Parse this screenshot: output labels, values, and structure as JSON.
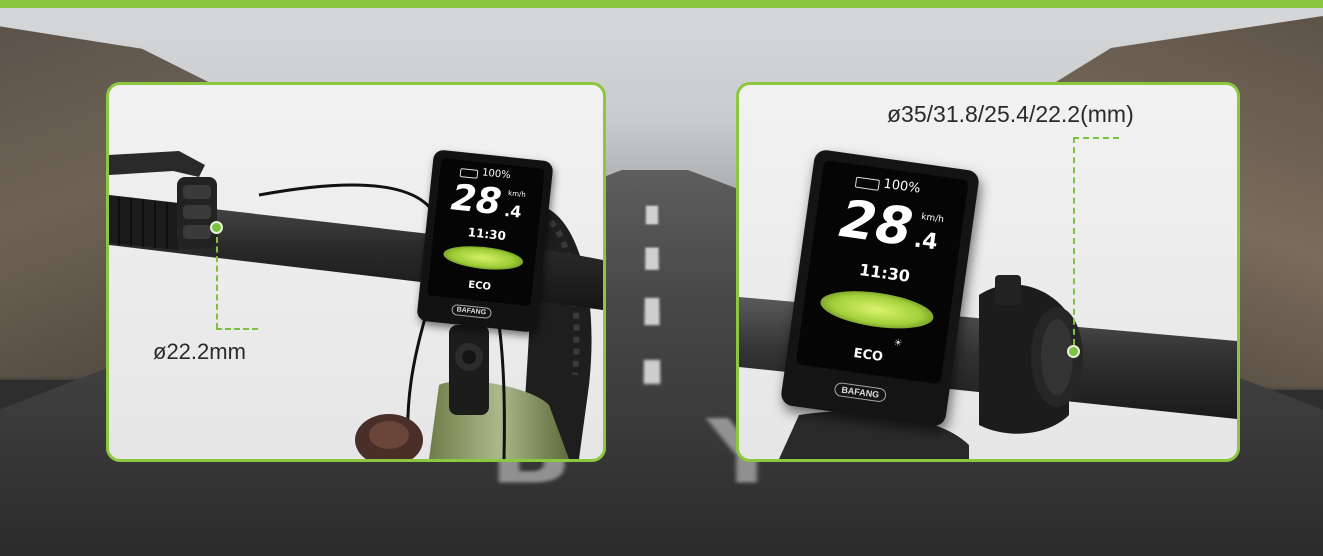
{
  "colors": {
    "accent_green": "#8cc83f",
    "marker_green": "#7dc143",
    "screen_green": "#b6e04a"
  },
  "left_panel": {
    "callout": "ø22.2mm",
    "display": {
      "battery": "100%",
      "speed_main": "28",
      "speed_decimal": ".4",
      "speed_unit": "km/h",
      "time": "11:30",
      "mode": "ECO",
      "brand": "BAFANG"
    }
  },
  "right_panel": {
    "callout": "ø35/31.8/25.4/22.2(mm)",
    "display": {
      "battery": "100%",
      "speed_main": "28",
      "speed_decimal": ".4",
      "speed_unit": "km/h",
      "time": "11:30",
      "mode": "ECO",
      "brand": "BAFANG"
    }
  }
}
